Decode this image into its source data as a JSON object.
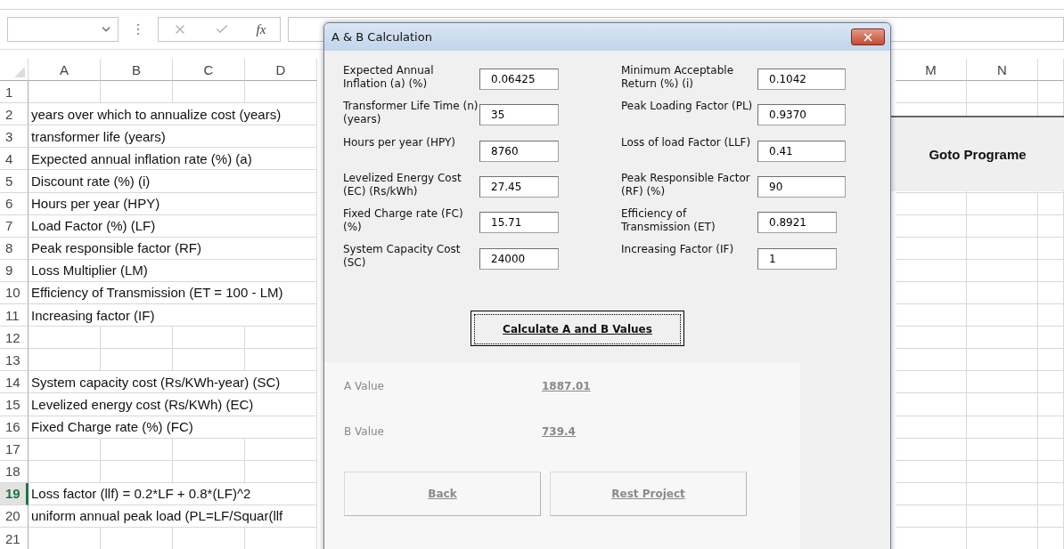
{
  "formula_bar": {
    "function_label": "fx"
  },
  "sheet": {
    "left_columns": [
      "A",
      "B",
      "C",
      "D"
    ],
    "right_columns": [
      "M",
      "N"
    ],
    "rows": [
      {
        "number": "1",
        "selected": false
      },
      {
        "number": "2",
        "selected": false,
        "text": "years over which to annualize cost (years)"
      },
      {
        "number": "3",
        "selected": false,
        "text": "transformer life (years)"
      },
      {
        "number": "4",
        "selected": false,
        "text": "Expected annual inflation rate (%) (a)"
      },
      {
        "number": "5",
        "selected": false,
        "text": "Discount rate (%) (i)"
      },
      {
        "number": "6",
        "selected": false,
        "text": "Hours per year (HPY)"
      },
      {
        "number": "7",
        "selected": false,
        "text": "Load Factor (%) (LF)"
      },
      {
        "number": "8",
        "selected": false,
        "text": "Peak responsible factor (RF)"
      },
      {
        "number": "9",
        "selected": false,
        "text": "Loss Multiplier (LM)"
      },
      {
        "number": "10",
        "selected": false,
        "text": "Efficiency of Transmission (ET = 100 - LM)"
      },
      {
        "number": "11",
        "selected": false,
        "text": "Increasing factor (IF)"
      },
      {
        "number": "12",
        "selected": false
      },
      {
        "number": "13",
        "selected": false
      },
      {
        "number": "14",
        "selected": false,
        "text": "System capacity cost (Rs/KWh-year) (SC)"
      },
      {
        "number": "15",
        "selected": false,
        "text": "Levelized energy cost (Rs/KWh) (EC)"
      },
      {
        "number": "16",
        "selected": false,
        "text": "Fixed Charge rate (%) (FC)"
      },
      {
        "number": "17",
        "selected": false
      },
      {
        "number": "18",
        "selected": false
      },
      {
        "number": "19",
        "selected": true,
        "text": "Loss factor (llf) = 0.2*LF + 0.8*(LF)^2"
      },
      {
        "number": "20",
        "selected": false,
        "text": "uniform annual peak load (PL=LF/Squar(llf"
      },
      {
        "number": "21",
        "selected": false
      }
    ],
    "goto_button": "Goto Programe"
  },
  "dialog": {
    "title": "A & B Calculation",
    "left_fields": [
      {
        "label": "Expected Annual Inflation (a) (%)",
        "value": "0.06425"
      },
      {
        "label": "Transformer Life Time (n) (years)",
        "value": "35"
      },
      {
        "label": "Hours per year (HPY)",
        "value": "8760"
      },
      {
        "label": "Levelized Energy Cost (EC) (Rs/kWh)",
        "value": "27.45"
      },
      {
        "label": "Fixed Charge rate (FC) (%)",
        "value": "15.71"
      },
      {
        "label": "System Capacity Cost (SC)",
        "value": "24000"
      }
    ],
    "right_fields": [
      {
        "label": "Minimum Acceptable Return (%)  (i)",
        "value": "0.1042"
      },
      {
        "label": "Peak Loading Factor (PL)",
        "value": "0.9370"
      },
      {
        "label": "Loss of load Factor (LLF)",
        "value": "0.41"
      },
      {
        "label": "Peak Responsible Factor (RF) (%)",
        "value": "90"
      },
      {
        "label": "Efficiency of Transmission (ET)",
        "value": "0.8921"
      },
      {
        "label": "Increasing Factor (IF)",
        "value": "1"
      }
    ],
    "calculate_button": "Calculate A  and B Values",
    "results": [
      {
        "label": "A Value",
        "value": "1887.01"
      },
      {
        "label": "B Value",
        "value": "739.4"
      }
    ],
    "buttons": [
      "Back",
      "Rest Project"
    ]
  }
}
